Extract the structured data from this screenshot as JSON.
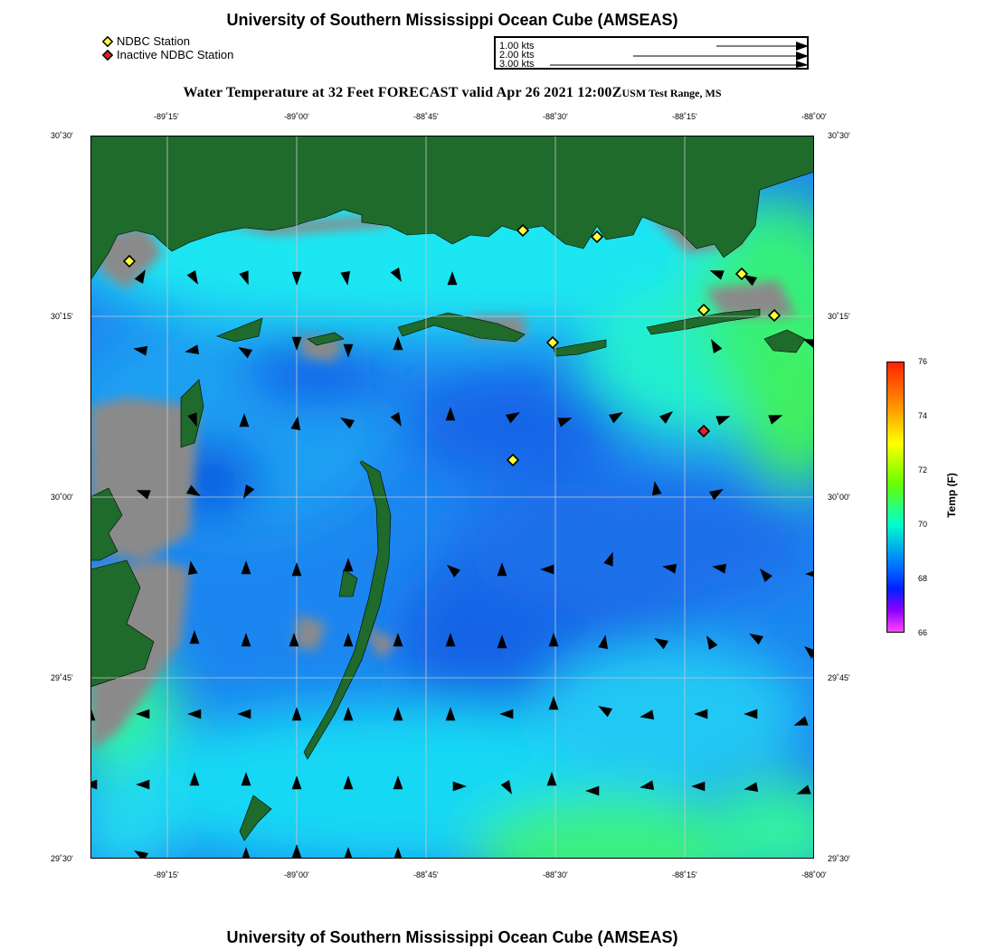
{
  "header": {
    "title": "University of Southern Mississippi Ocean Cube (AMSEAS)",
    "subtitle_main": "Water Temperature at 32 Feet FORECAST valid Apr 26 2021 12:00Z",
    "subtitle_region": "USM Test Range, MS"
  },
  "footer": {
    "title": "University of Southern Mississippi Ocean Cube (AMSEAS)"
  },
  "station_legend": {
    "active_label": "NDBC Station",
    "inactive_label": "Inactive NDBC Station",
    "active_color": "#ffff33",
    "inactive_color": "#dd2222"
  },
  "vector_legend": {
    "items": [
      "1.00 kts",
      "2.00 kts",
      "3.00 kts"
    ]
  },
  "map": {
    "lon_ticks": [
      "-89˚15'",
      "-89˚00'",
      "-88˚45'",
      "-88˚30'",
      "-88˚15'",
      "-88˚00'"
    ],
    "lat_ticks": [
      "30˚30'",
      "30˚15'",
      "30˚00'",
      "29˚45'",
      "29˚30'"
    ],
    "land_color": "#1e6b2c",
    "gray_color": "#8a8a8a"
  },
  "colorbar": {
    "label": "Temp (F)",
    "ticks": [
      "76",
      "74",
      "72",
      "70",
      "68",
      "66"
    ],
    "colors": [
      "#ff2200",
      "#ffcc00",
      "#33ff00",
      "#00ffdd",
      "#0060ff",
      "#5500ff",
      "#ff33ff"
    ]
  }
}
